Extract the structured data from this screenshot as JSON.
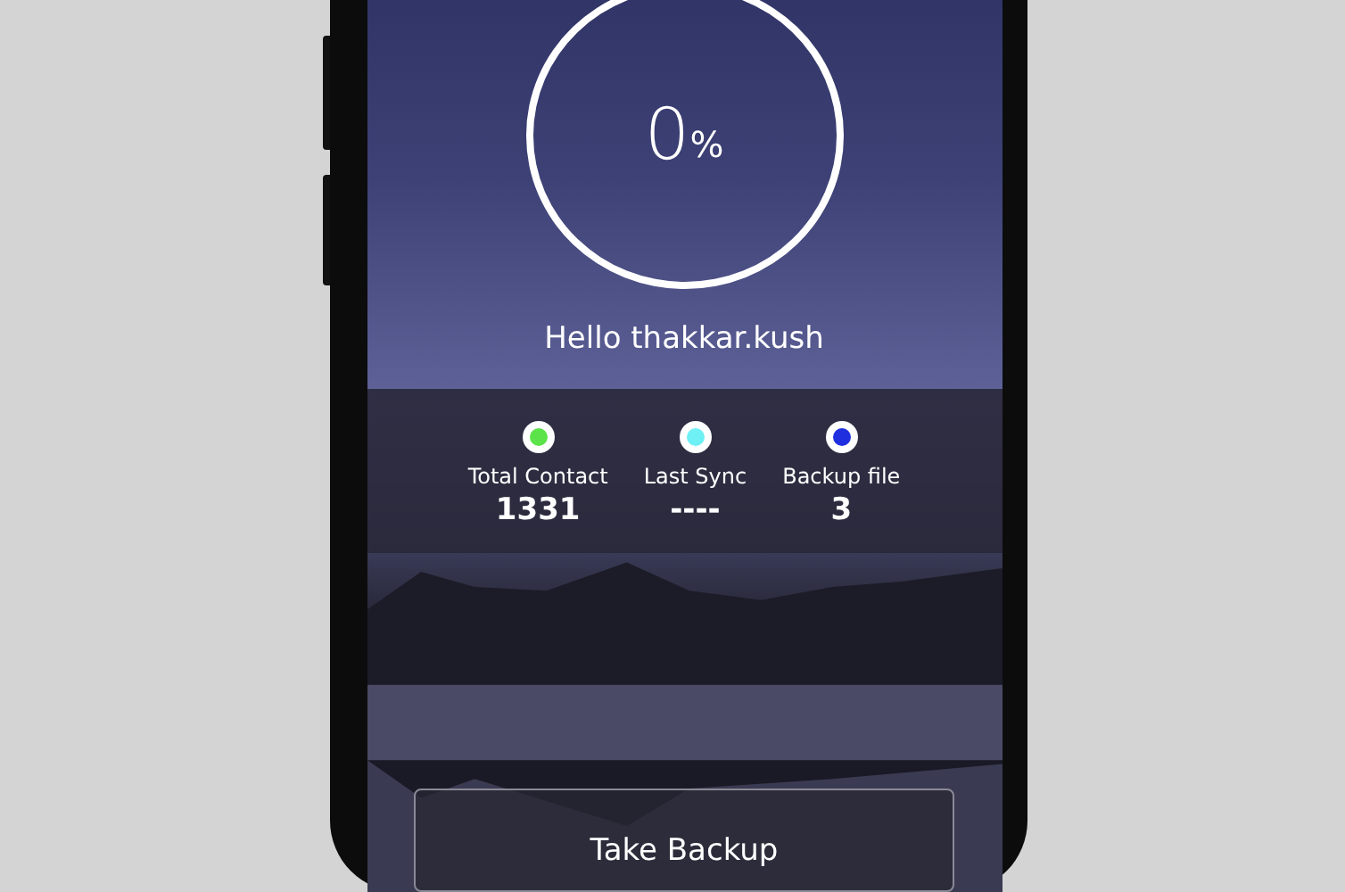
{
  "progress": {
    "value": "0",
    "unit": "%"
  },
  "greeting": "Hello thakkar.kush",
  "stats": [
    {
      "label": "Total Contact",
      "value": "1331",
      "color": "#5de34a"
    },
    {
      "label": "Last Sync",
      "value": "----",
      "color": "#6ef0f5"
    },
    {
      "label": "Backup file",
      "value": "3",
      "color": "#1f2fe0"
    }
  ],
  "button": {
    "label": "Take Backup"
  }
}
